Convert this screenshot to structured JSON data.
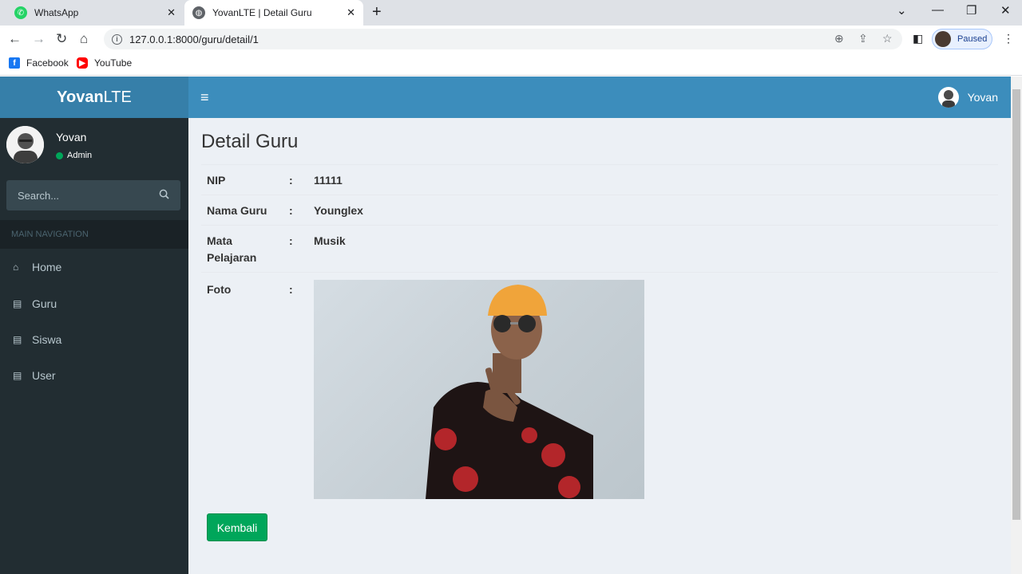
{
  "browser": {
    "tabs": [
      {
        "title": "WhatsApp",
        "icon": "whatsapp-icon",
        "color": "#25d366"
      },
      {
        "title": "YovanLTE | Detail Guru",
        "icon": "globe-icon",
        "color": "#5f6368"
      }
    ],
    "url": "127.0.0.1:8000/guru/detail/1",
    "profile_label": "Paused",
    "bookmarks": [
      {
        "label": "Facebook",
        "icon": "facebook-icon",
        "color": "#1877f2"
      },
      {
        "label": "YouTube",
        "icon": "youtube-icon",
        "color": "#ff0000"
      }
    ]
  },
  "app": {
    "logo_bold": "Yovan",
    "logo_light": "LTE",
    "header_user": "Yovan",
    "accent": "#3c8dbc"
  },
  "sidebar": {
    "user_name": "Yovan",
    "user_role": "Admin",
    "search_placeholder": "Search...",
    "nav_header": "MAIN NAVIGATION",
    "items": [
      {
        "label": "Home",
        "icon": "home-icon"
      },
      {
        "label": "Guru",
        "icon": "book-icon"
      },
      {
        "label": "Siswa",
        "icon": "book-icon"
      },
      {
        "label": "User",
        "icon": "book-icon"
      }
    ]
  },
  "content": {
    "title": "Detail Guru",
    "fields": [
      {
        "label": "NIP",
        "colon": ":",
        "value": "11111"
      },
      {
        "label": "Nama Guru",
        "colon": ":",
        "value": "Younglex"
      },
      {
        "label": "Mata Pelajaran",
        "colon": ":",
        "value": "Musik"
      },
      {
        "label": "Foto",
        "colon": ":",
        "value": ""
      }
    ],
    "back_button": "Kembali",
    "button_color": "#00a65a"
  }
}
